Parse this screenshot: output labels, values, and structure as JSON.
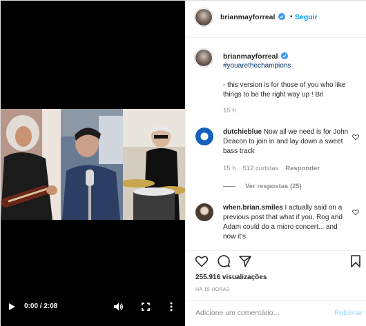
{
  "author": {
    "username": "brianmayforreal",
    "separator": "•",
    "follow_label": "Seguir"
  },
  "caption": {
    "username": "brianmayforreal",
    "hashtag": "#youarethechampions",
    "text": "- this version is for those of you who like things to be the right way up ! Bri",
    "time": "15 h"
  },
  "comments": [
    {
      "username": "dutchieblue",
      "text": "Now all we need is for John Deacon to join in and lay down a sweet bass track",
      "time": "15 h",
      "likes": "512 curtidas",
      "reply_label": "Responder"
    },
    {
      "username": "when.brian.smiles",
      "text": "I actually said on a previous post that what if you, Rog and Adam could do a micro concert... and now it's"
    }
  ],
  "view_replies": "Ver respostas (25)",
  "stats": {
    "views": "255.916 visualizações",
    "posted_ago": "HÁ 15 HORAS"
  },
  "add_comment": {
    "placeholder": "Adicione um comentário...",
    "post_label": "Publicar"
  },
  "video": {
    "time": "0:00 / 2:08",
    "progress": 0
  },
  "icons": {
    "play": "play-icon",
    "volume": "volume-icon",
    "fullscreen": "fullscreen-icon",
    "more": "more-vertical-icon",
    "like": "heart-icon",
    "comment": "comment-icon",
    "share": "share-icon",
    "save": "bookmark-icon",
    "verified": "verified-badge-icon"
  },
  "colors": {
    "link_blue": "#0095f6",
    "hashtag": "#00376b",
    "verified": "#3897f0",
    "muted": "#8e8e8e",
    "publish_disabled": "#b2dffc"
  }
}
